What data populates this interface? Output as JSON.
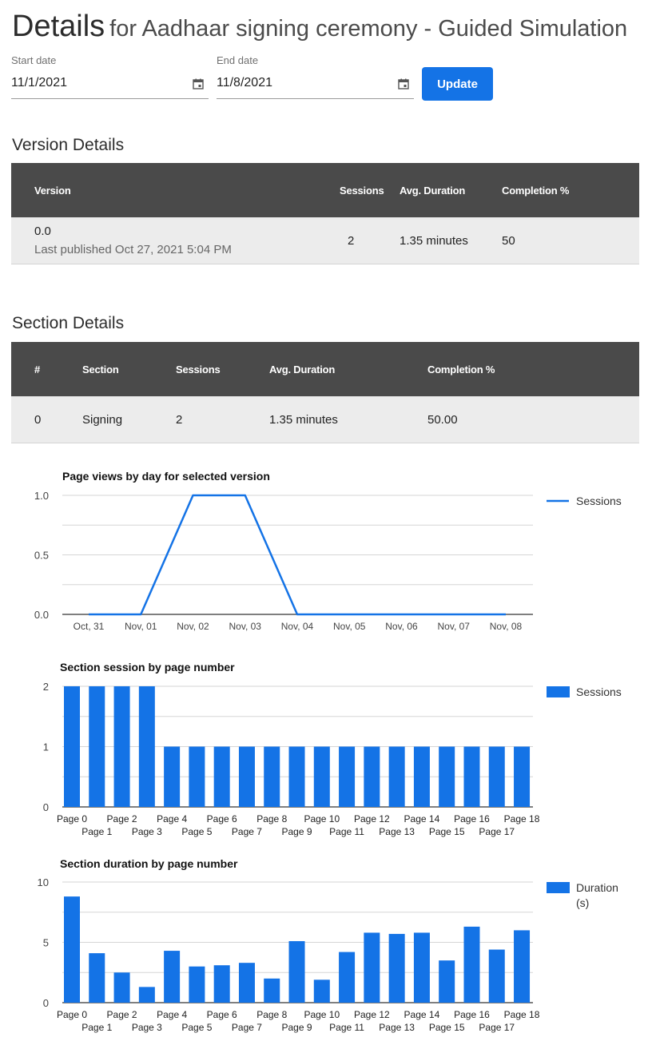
{
  "header": {
    "title": "Details",
    "subtitle": "for Aadhaar signing ceremony - Guided Simulation"
  },
  "filters": {
    "start_label": "Start date",
    "start_value": "11/1/2021",
    "end_label": "End date",
    "end_value": "11/8/2021",
    "update_label": "Update"
  },
  "version_details": {
    "title": "Version Details",
    "columns": [
      "Version",
      "Sessions",
      "Avg. Duration",
      "Completion %"
    ],
    "row": {
      "version": "0.0",
      "published": "Last published Oct 27, 2021 5:04 PM",
      "sessions": "2",
      "avg_duration": "1.35 minutes",
      "completion": "50"
    }
  },
  "section_details": {
    "title": "Section Details",
    "columns": [
      "#",
      "Section",
      "Sessions",
      "Avg. Duration",
      "Completion %"
    ],
    "row": {
      "num": "0",
      "section": "Signing",
      "sessions": "2",
      "avg_duration": "1.35 minutes",
      "completion": "50.00"
    }
  },
  "colors": {
    "accent": "#1473e6",
    "header_bg": "#4a4a4a",
    "row_bg": "#ececec"
  },
  "chart_data": [
    {
      "type": "line",
      "title": "Page views by day for selected version",
      "categories": [
        "Oct, 31",
        "Nov, 01",
        "Nov, 02",
        "Nov, 03",
        "Nov, 04",
        "Nov, 05",
        "Nov, 06",
        "Nov, 07",
        "Nov, 08"
      ],
      "series": [
        {
          "name": "Sessions",
          "values": [
            0,
            0,
            1,
            1,
            0,
            0,
            0,
            0,
            0
          ]
        }
      ],
      "yticks": [
        "0.0",
        "0.5",
        "1.0"
      ],
      "ylim": [
        0,
        1
      ],
      "legend": "right",
      "grid": true
    },
    {
      "type": "bar",
      "title": "Section session by page number",
      "categories": [
        "Page 0",
        "Page 1",
        "Page 2",
        "Page 3",
        "Page 4",
        "Page 5",
        "Page 6",
        "Page 7",
        "Page 8",
        "Page 9",
        "Page 10",
        "Page 11",
        "Page 12",
        "Page 13",
        "Page 14",
        "Page 15",
        "Page 16",
        "Page 17",
        "Page 18"
      ],
      "series": [
        {
          "name": "Sessions",
          "values": [
            2,
            2,
            2,
            2,
            1,
            1,
            1,
            1,
            1,
            1,
            1,
            1,
            1,
            1,
            1,
            1,
            1,
            1,
            1
          ]
        }
      ],
      "yticks": [
        "0",
        "1",
        "2"
      ],
      "ylim": [
        0,
        2
      ],
      "legend": "right",
      "grid": true
    },
    {
      "type": "bar",
      "title": "Section duration by page number",
      "categories": [
        "Page 0",
        "Page 1",
        "Page 2",
        "Page 3",
        "Page 4",
        "Page 5",
        "Page 6",
        "Page 7",
        "Page 8",
        "Page 9",
        "Page 10",
        "Page 11",
        "Page 12",
        "Page 13",
        "Page 14",
        "Page 15",
        "Page 16",
        "Page 17",
        "Page 18"
      ],
      "series": [
        {
          "name": "Duration (s)",
          "values": [
            8.8,
            4.1,
            2.5,
            1.3,
            4.3,
            3.0,
            3.1,
            3.3,
            2.0,
            5.1,
            1.9,
            4.2,
            5.8,
            5.7,
            5.8,
            3.5,
            6.3,
            4.4,
            6.0
          ]
        }
      ],
      "yticks": [
        "0",
        "5",
        "10"
      ],
      "ylim": [
        0,
        10
      ],
      "legend": "right",
      "grid": true
    }
  ]
}
